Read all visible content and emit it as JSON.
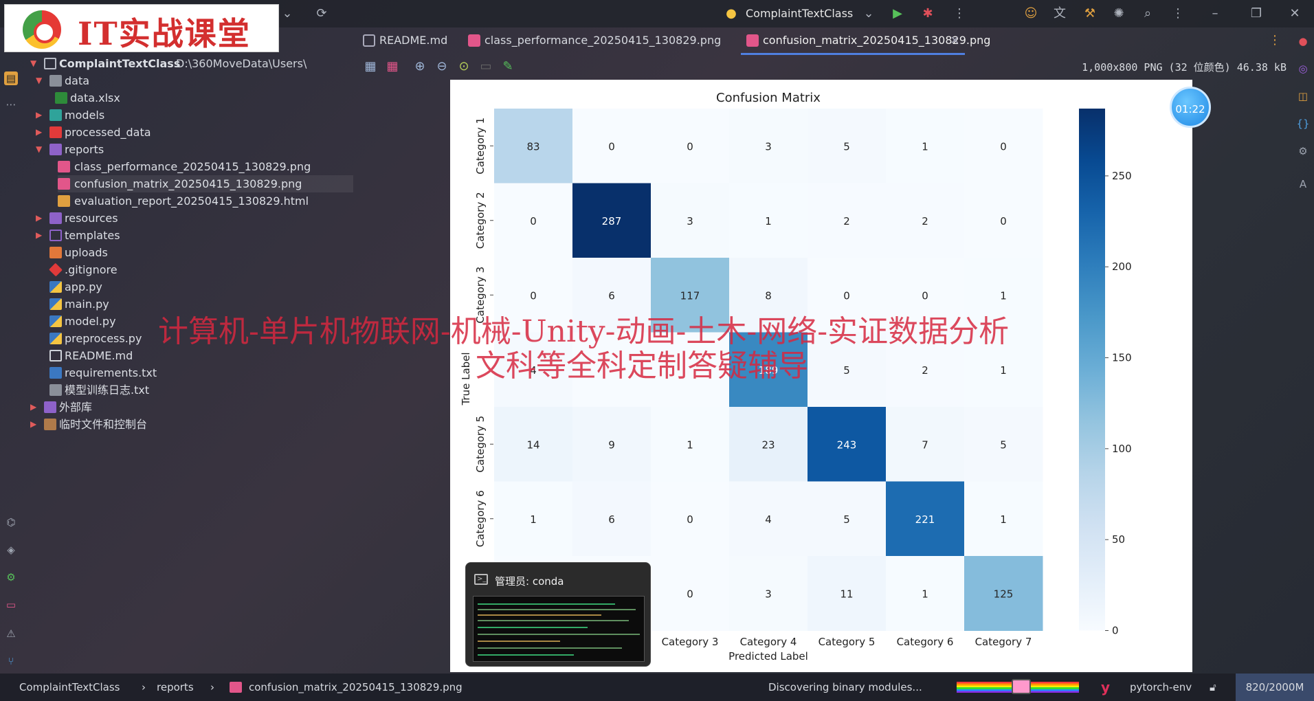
{
  "logo": {
    "text": "IT实战课堂"
  },
  "topbar": {
    "project_name": "ComplaintTextClass"
  },
  "tabs": [
    {
      "label": "README.md",
      "icon": "markdown-icon"
    },
    {
      "label": "class_performance_20250415_130829.png",
      "icon": "image-icon"
    },
    {
      "label": "confusion_matrix_20250415_130829.png",
      "icon": "image-icon",
      "active": true
    }
  ],
  "tree": {
    "root_label": "ComplaintTextClass",
    "root_path": "D:\\360MoveData\\Users\\",
    "items": [
      {
        "label": "data"
      },
      {
        "label": "data.xlsx"
      },
      {
        "label": "models"
      },
      {
        "label": "processed_data"
      },
      {
        "label": "reports"
      },
      {
        "label": "class_performance_20250415_130829.png"
      },
      {
        "label": "confusion_matrix_20250415_130829.png"
      },
      {
        "label": "evaluation_report_20250415_130829.html"
      },
      {
        "label": "resources"
      },
      {
        "label": "templates"
      },
      {
        "label": "uploads"
      },
      {
        "label": ".gitignore"
      },
      {
        "label": "app.py"
      },
      {
        "label": "main.py"
      },
      {
        "label": "model.py"
      },
      {
        "label": "preprocess.py"
      },
      {
        "label": "README.md"
      },
      {
        "label": "requirements.txt"
      },
      {
        "label": "模型训练日志.txt"
      },
      {
        "label": "外部库"
      },
      {
        "label": "临时文件和控制台"
      }
    ]
  },
  "image_info": "1,000x800 PNG (32 位颜色) 46.38 kB",
  "timer": "01:22",
  "overlay": {
    "line1": "计算机-单片机物联网-机械-Unity-动画-土木-网络-实证数据分析",
    "line2": "文科等全科定制答疑辅导"
  },
  "conda": {
    "title": "管理员: conda"
  },
  "statusbar": {
    "crumb1": "ComplaintTextClass",
    "crumb2": "reports",
    "crumb3": "confusion_matrix_20250415_130829.png",
    "task": "Discovering binary modules...",
    "env": "pytorch-env",
    "memory": "820/2000M"
  },
  "chart_data": {
    "type": "heatmap",
    "title": "Confusion Matrix",
    "xlabel": "Predicted Label",
    "ylabel": "True Label",
    "categories": [
      "Category 1",
      "Category 2",
      "Category 3",
      "Category 4",
      "Category 5",
      "Category 6",
      "Category 7"
    ],
    "x_tick_labels": [
      "Category 3",
      "Category 4",
      "Category 5",
      "Category 6",
      "Category 7"
    ],
    "y_tick_labels": [
      "Category 1",
      "Category 2",
      "Category 3",
      "Category 5",
      "Category 6"
    ],
    "matrix": [
      [
        83,
        0,
        0,
        3,
        5,
        1,
        0
      ],
      [
        0,
        287,
        3,
        1,
        2,
        2,
        0
      ],
      [
        0,
        6,
        117,
        8,
        0,
        0,
        1
      ],
      [
        4,
        null,
        null,
        189,
        5,
        2,
        1
      ],
      [
        14,
        9,
        1,
        23,
        243,
        7,
        5
      ],
      [
        1,
        6,
        0,
        4,
        5,
        221,
        1
      ],
      [
        null,
        null,
        0,
        3,
        11,
        1,
        125
      ]
    ],
    "colorbar": {
      "ticks": [
        0,
        50,
        100,
        150,
        200,
        250
      ],
      "vmin": 0,
      "vmax": 287,
      "colormap": "Blues"
    }
  },
  "colors": {
    "accent": "#4f7fe0",
    "brand_red": "#d32f2f"
  }
}
